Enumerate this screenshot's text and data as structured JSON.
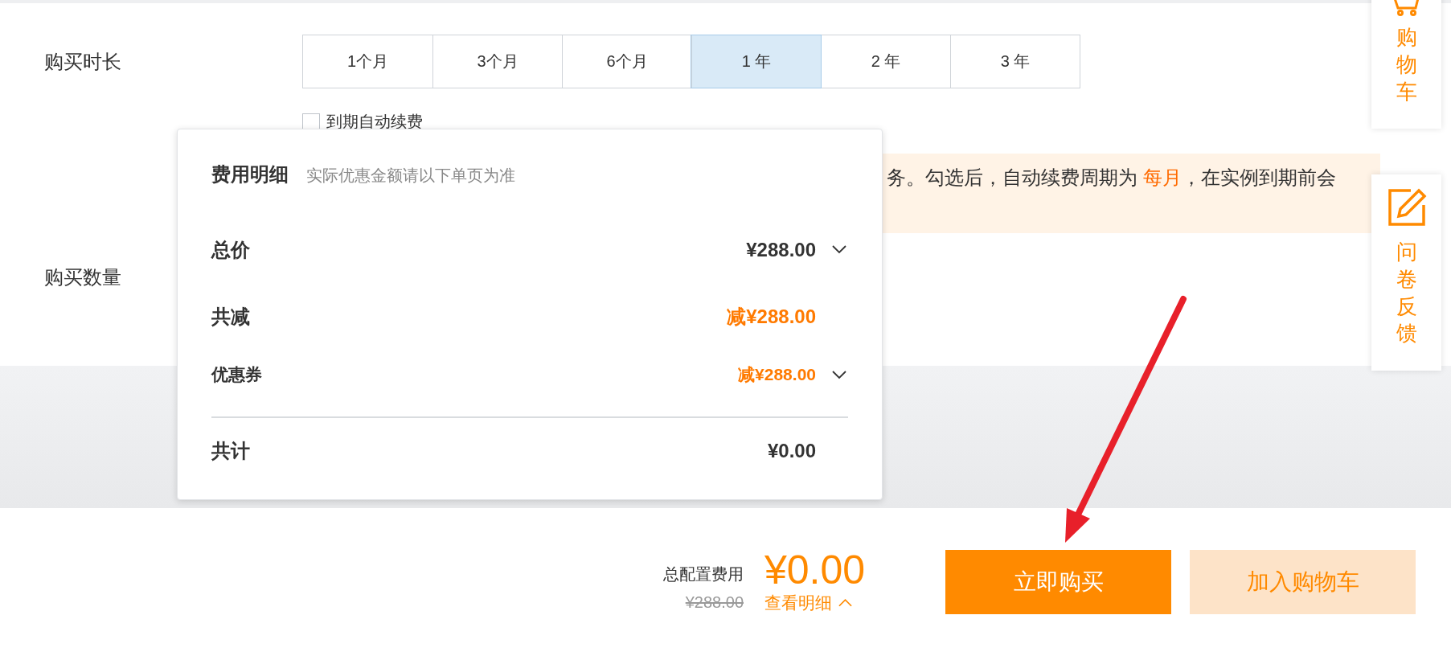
{
  "duration": {
    "label": "购买时长",
    "options": [
      {
        "label": "1个月",
        "selected": false
      },
      {
        "label": "3个月",
        "selected": false
      },
      {
        "label": "6个月",
        "selected": false
      },
      {
        "label": "1 年",
        "selected": true
      },
      {
        "label": "2 年",
        "selected": false
      },
      {
        "label": "3 年",
        "selected": false
      }
    ],
    "auto_renew": {
      "label": "到期自动续费",
      "checked": false
    }
  },
  "notice": {
    "before": "务。勾选后，自动续费周期为 ",
    "highlight": "每月",
    "after": "，在实例到期前会"
  },
  "quantity": {
    "label": "购买数量"
  },
  "cost_popup": {
    "title": "费用明细",
    "note": "实际优惠金额请以下单页为准",
    "rows": [
      {
        "label": "总价",
        "value": "¥288.00",
        "kind": "total",
        "expandable": true
      },
      {
        "label": "共减",
        "value": "减¥288.00",
        "kind": "discount",
        "expandable": false
      },
      {
        "label": "优惠券",
        "value": "减¥288.00",
        "kind": "coupon",
        "expandable": true
      }
    ],
    "sum": {
      "label": "共计",
      "value": "¥0.00"
    }
  },
  "side_tools": [
    {
      "label": "购物车",
      "kind": "cart"
    },
    {
      "label": "问卷反馈",
      "kind": "survey"
    }
  ],
  "footer": {
    "total_label": "总配置费用",
    "total": "¥0.00",
    "original": "¥288.00",
    "details_link": "查看明细",
    "details_expanded": true,
    "buttons": [
      {
        "label": "立即购买",
        "kind": "primary"
      },
      {
        "label": "加入购物车",
        "kind": "secondary"
      }
    ]
  }
}
